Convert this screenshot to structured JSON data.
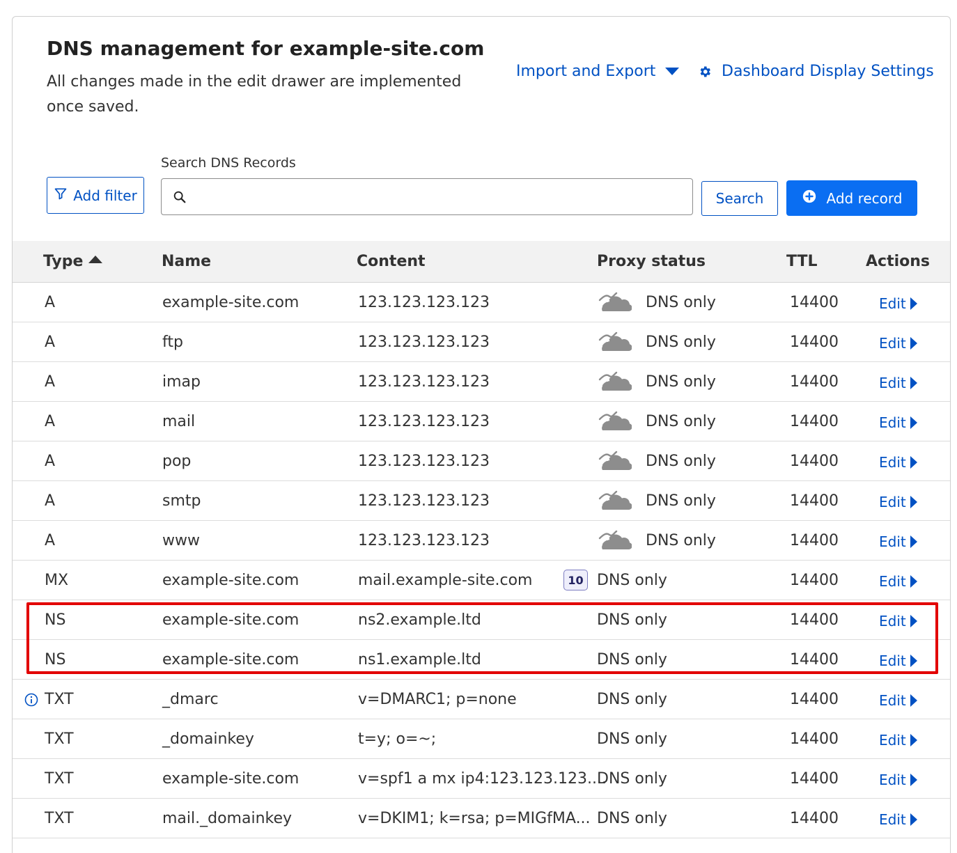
{
  "header": {
    "title_prefix": "DNS management for ",
    "domain": "example-site.com",
    "subtitle": "All changes made in the edit drawer are implemented once saved.",
    "import_export_label": "Import and Export",
    "display_settings_label": "Dashboard Display Settings"
  },
  "toolbar": {
    "add_filter_label": "Add filter",
    "search_label": "Search DNS Records",
    "search_value": "",
    "search_button_label": "Search",
    "add_record_label": "Add record"
  },
  "table": {
    "headers": {
      "type": "Type",
      "name": "Name",
      "content": "Content",
      "proxy": "Proxy status",
      "ttl": "TTL",
      "actions": "Actions"
    },
    "edit_label": "Edit",
    "rows": [
      {
        "type": "A",
        "name": "example-site.com",
        "content": "123.123.123.123",
        "proxy": "DNS only",
        "ttl": "14400",
        "cloud": true
      },
      {
        "type": "A",
        "name": "ftp",
        "content": "123.123.123.123",
        "proxy": "DNS only",
        "ttl": "14400",
        "cloud": true
      },
      {
        "type": "A",
        "name": "imap",
        "content": "123.123.123.123",
        "proxy": "DNS only",
        "ttl": "14400",
        "cloud": true
      },
      {
        "type": "A",
        "name": "mail",
        "content": "123.123.123.123",
        "proxy": "DNS only",
        "ttl": "14400",
        "cloud": true
      },
      {
        "type": "A",
        "name": "pop",
        "content": "123.123.123.123",
        "proxy": "DNS only",
        "ttl": "14400",
        "cloud": true
      },
      {
        "type": "A",
        "name": "smtp",
        "content": "123.123.123.123",
        "proxy": "DNS only",
        "ttl": "14400",
        "cloud": true
      },
      {
        "type": "A",
        "name": "www",
        "content": "123.123.123.123",
        "proxy": "DNS only",
        "ttl": "14400",
        "cloud": true
      },
      {
        "type": "MX",
        "name": "example-site.com",
        "content": "mail.example-site.com",
        "priority": "10",
        "proxy": "DNS only",
        "ttl": "14400"
      },
      {
        "type": "NS",
        "name": "example-site.com",
        "content": "ns2.example.ltd",
        "proxy": "DNS only",
        "ttl": "14400"
      },
      {
        "type": "NS",
        "name": "example-site.com",
        "content": "ns1.example.ltd",
        "proxy": "DNS only",
        "ttl": "14400"
      },
      {
        "type": "TXT",
        "name": "_dmarc",
        "content": "v=DMARC1; p=none",
        "proxy": "DNS only",
        "ttl": "14400",
        "info": true
      },
      {
        "type": "TXT",
        "name": "_domainkey",
        "content": "t=y; o=~;",
        "proxy": "DNS only",
        "ttl": "14400"
      },
      {
        "type": "TXT",
        "name": "example-site.com",
        "content": "v=spf1 a mx ip4:123.123.123....",
        "proxy": "DNS only",
        "ttl": "14400"
      },
      {
        "type": "TXT",
        "name": "mail._domainkey",
        "content": "v=DKIM1; k=rsa; p=MIGfMA...",
        "proxy": "DNS only",
        "ttl": "14400"
      }
    ]
  },
  "colors": {
    "link": "#0051c3",
    "primary_button": "#0a6ef2",
    "highlight": "#e20000",
    "cloud_gray": "#8d8d8d"
  }
}
